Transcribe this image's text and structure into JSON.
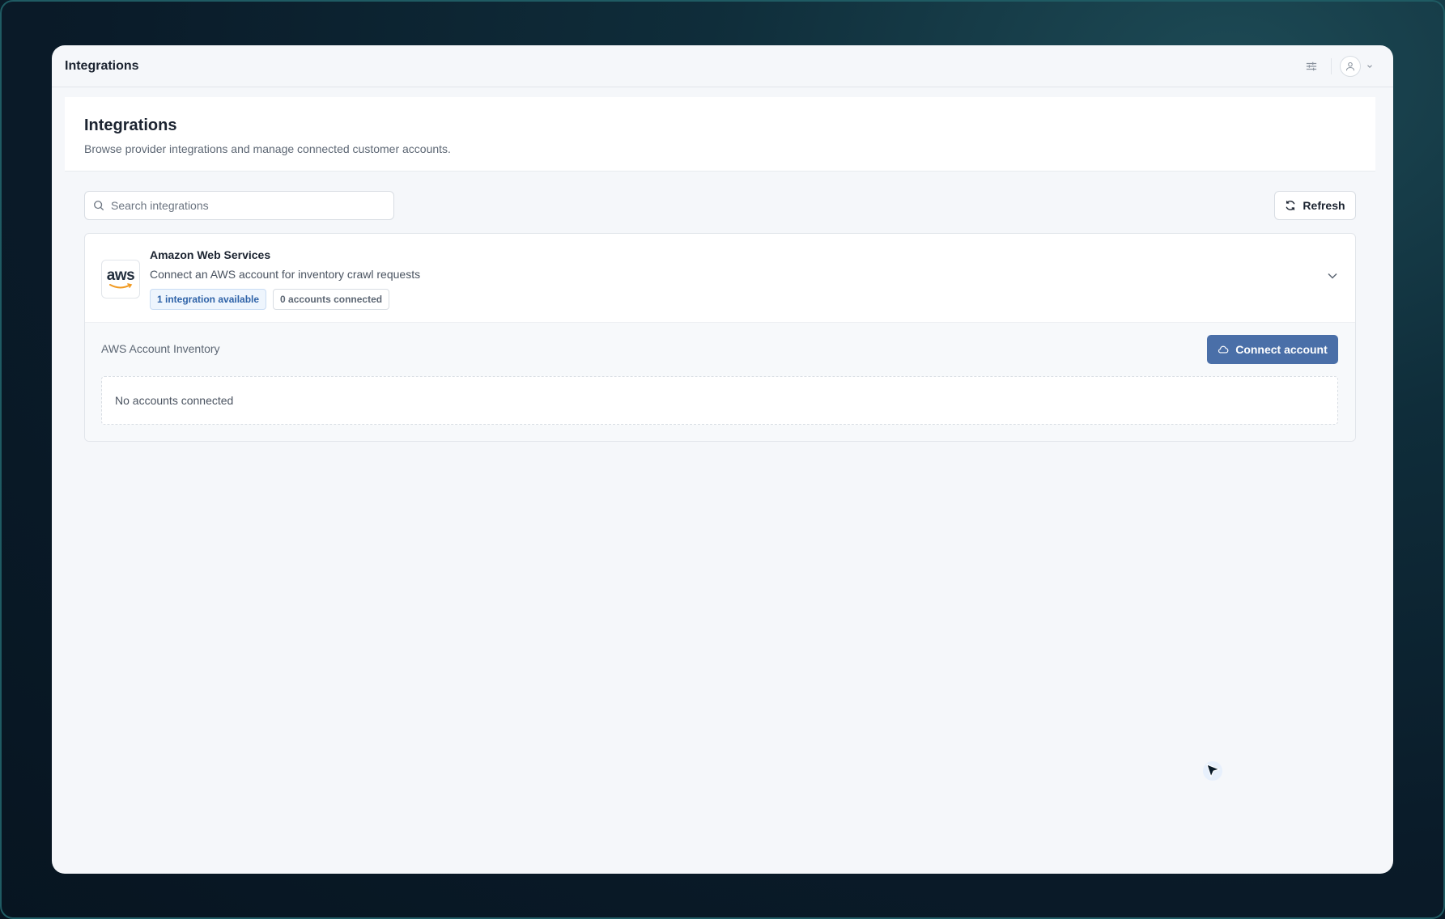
{
  "topbar": {
    "title": "Integrations"
  },
  "header": {
    "title": "Integrations",
    "subtitle": "Browse provider integrations and manage connected customer accounts."
  },
  "search": {
    "placeholder": "Search integrations",
    "value": ""
  },
  "toolbar": {
    "refresh_label": "Refresh"
  },
  "provider": {
    "logo_text": "aws",
    "name": "Amazon Web Services",
    "description": "Connect an AWS account for inventory crawl requests",
    "badges": {
      "available": "1 integration available",
      "connected": "0 accounts connected"
    },
    "expanded": true,
    "integration": {
      "name": "AWS Account Inventory",
      "connect_label": "Connect account",
      "empty_text": "No accounts connected"
    }
  },
  "colors": {
    "accent": "#4a6fa8",
    "badge_blue_text": "#2f63a8",
    "aws_orange": "#f19a22"
  },
  "icons": [
    "sliders-icon",
    "user-icon",
    "chevron-down-icon",
    "search-icon",
    "refresh-icon",
    "cloud-icon",
    "cursor-icon"
  ]
}
